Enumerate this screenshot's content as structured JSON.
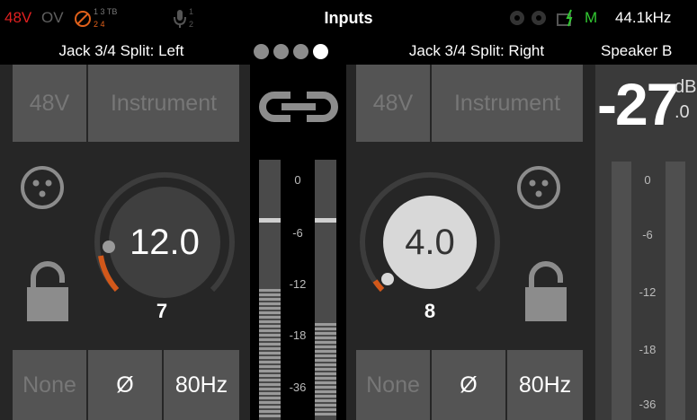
{
  "status": {
    "phantom": "48V",
    "overload": "OV",
    "talkback_top": "1 3 TB",
    "talkback_bottom": "2 4",
    "mic_top": "1",
    "mic_bottom": "2",
    "title": "Inputs",
    "mode_label": "M",
    "sample_rate": "44.1kHz",
    "colors": {
      "phantom": "#e02020",
      "overload": "#606060",
      "accent": "#e0601a",
      "green": "#32c832"
    }
  },
  "pager": {
    "dots": 4,
    "active_index": 3
  },
  "left_channel": {
    "title": "Jack 3/4 Split: Left",
    "phantom_btn": "48V",
    "instrument_btn": "Instrument",
    "gain_value": "12.0",
    "gain_fraction": 0.18,
    "channel_number": "7",
    "filter_btn": "None",
    "phase_btn": "Ø",
    "hpf_btn": "80Hz"
  },
  "right_channel": {
    "title": "Jack 3/4 Split: Right",
    "phantom_btn": "48V",
    "instrument_btn": "Instrument",
    "gain_value": "4.0",
    "gain_fraction": 0.06,
    "channel_number": "8",
    "filter_btn": "None",
    "phase_btn": "Ø",
    "hpf_btn": "80Hz"
  },
  "meter_scale": [
    "0",
    "-6",
    "-12",
    "-18",
    "-36"
  ],
  "speaker": {
    "title": "Speaker B",
    "level_big": "-27",
    "level_unit": "dB",
    "level_decimal": ".0"
  },
  "icons": [
    "link-icon",
    "xlr-icon",
    "lock-icon",
    "headphone-icon",
    "mic-icon",
    "power-icon"
  ]
}
